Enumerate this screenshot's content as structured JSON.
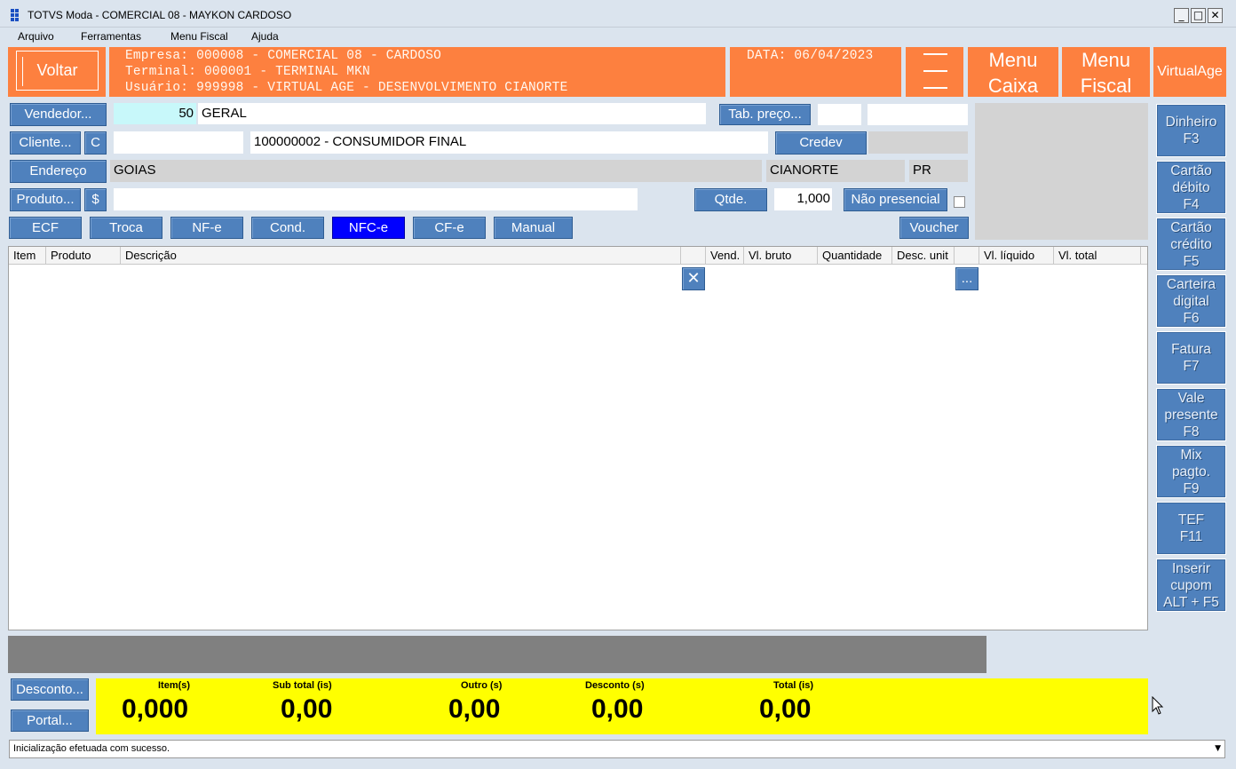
{
  "window": {
    "title": "TOTVS Moda - COMERCIAL 08 - MAYKON CARDOSO",
    "minimize": "_",
    "maximize": "□",
    "close": "✕"
  },
  "menu": [
    "Arquivo",
    "Ferramentas",
    "Menu Fiscal",
    "Ajuda"
  ],
  "header": {
    "voltar": "Voltar",
    "empresa": "Empresa: 000008 - COMERCIAL 08 - CARDOSO",
    "terminal": "Terminal: 000001 - TERMINAL MKN",
    "usuario": "Usuário: 999998 - VIRTUAL AGE - DESENVOLVIMENTO CIANORTE",
    "data": "DATA: 06/04/2023",
    "menu_caixa_1": "Menu",
    "menu_caixa_2": "Caixa",
    "menu_fiscal_1": "Menu",
    "menu_fiscal_2": "Fiscal",
    "brand": "VirtualAge"
  },
  "form": {
    "vendedor_btn": "Vendedor...",
    "vendedor_code": "50",
    "vendedor_name": "GERAL",
    "tab_preco_btn": "Tab. preço...",
    "cliente_btn": "Cliente...",
    "cliente_c_btn": "C",
    "cliente_value": "100000002 - CONSUMIDOR FINAL",
    "credev_btn": "Credev",
    "endereco_btn": "Endereço",
    "endereco_value": "GOIAS",
    "cidade": "CIANORTE",
    "uf": "PR",
    "produto_btn": "Produto...",
    "dollar_btn": "$",
    "qtde_btn": "Qtde.",
    "qtde_value": "1,000",
    "nao_presencial_btn": "Não presencial"
  },
  "doc_buttons": [
    "ECF",
    "Troca",
    "NF-e",
    "Cond.",
    "NFC-e",
    "CF-e",
    "Manual"
  ],
  "voucher_btn": "Voucher",
  "grid": {
    "columns": [
      "Item",
      "Produto",
      "Descrição",
      "Vend.",
      "Vl. bruto",
      "Quantidade",
      "Desc. unit",
      "Vl. líquido",
      "Vl. total"
    ],
    "delete_icon": "✕",
    "more_btn": "..."
  },
  "side_buttons": [
    {
      "l1": "Dinheiro",
      "l2": "F3"
    },
    {
      "l1": "Cartão",
      "l2": "débito",
      "l3": "F4"
    },
    {
      "l1": "Cartão",
      "l2": "crédito",
      "l3": "F5"
    },
    {
      "l1": "Carteira",
      "l2": "digital",
      "l3": "F6"
    },
    {
      "l1": "Fatura",
      "l2": "F7"
    },
    {
      "l1": "Vale",
      "l2": "presente",
      "l3": "F8"
    },
    {
      "l1": "Mix",
      "l2": "pagto.",
      "l3": "F9"
    },
    {
      "l1": "TEF",
      "l2": "F11"
    },
    {
      "l1": "Inserir",
      "l2": "cupom",
      "l3": "ALT + F5"
    }
  ],
  "bottom": {
    "desconto_btn": "Desconto...",
    "portal_btn": "Portal..."
  },
  "totals": [
    {
      "label": "Item(s)",
      "value": "0,000"
    },
    {
      "label": "Sub total (is)",
      "value": "0,00"
    },
    {
      "label": "Outro (s)",
      "value": "0,00"
    },
    {
      "label": "Desconto (s)",
      "value": "0,00"
    },
    {
      "label": "Total (is)",
      "value": "0,00"
    }
  ],
  "status": "Inicialização efetuada com sucesso."
}
